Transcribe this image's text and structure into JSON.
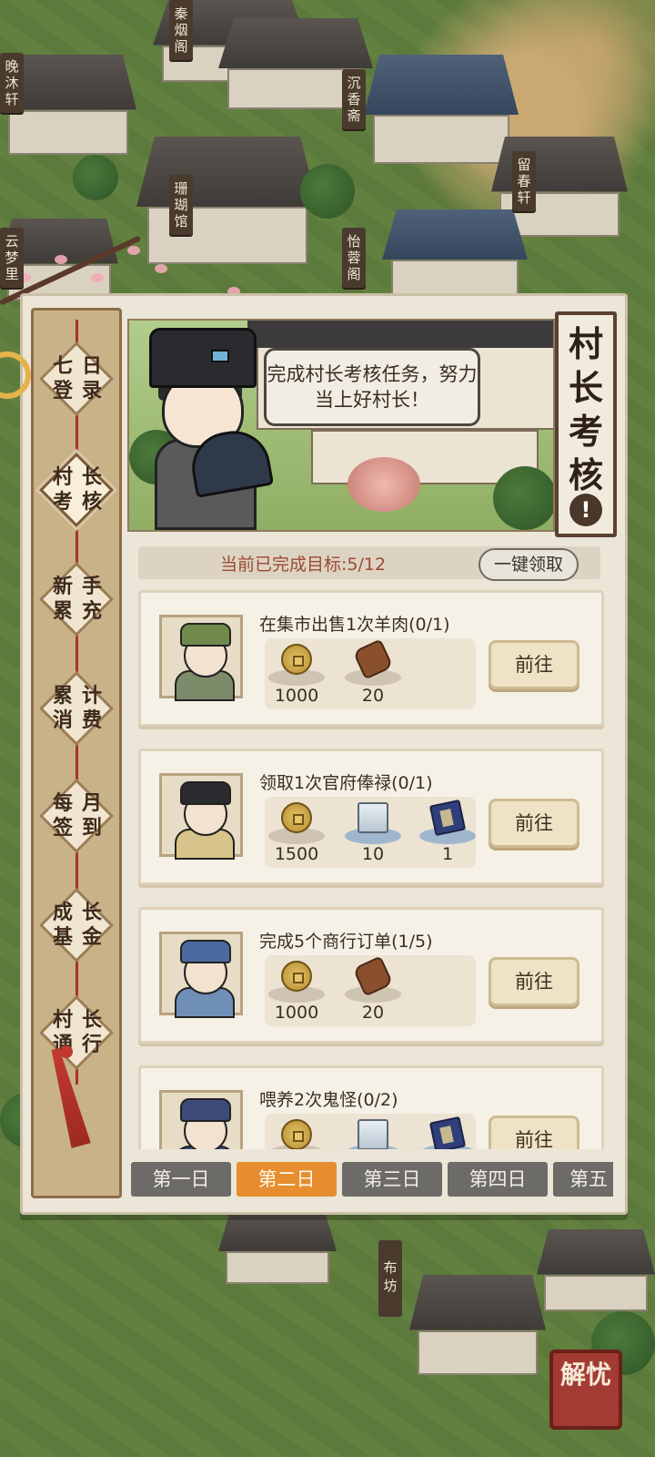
{
  "map": {
    "building_signs": [
      "秦烟阁",
      "晚沐轩",
      "沉香斋",
      "珊瑚馆",
      "留春轩",
      "云梦里",
      "怡蓉阁",
      "布坊"
    ]
  },
  "sidebar": {
    "items": [
      {
        "label": "七日登录",
        "active": false
      },
      {
        "label": "村长考核",
        "active": true
      },
      {
        "label": "新手累充",
        "active": false
      },
      {
        "label": "累计消费",
        "active": false
      },
      {
        "label": "每月签到",
        "active": false
      },
      {
        "label": "成长基金",
        "active": false
      },
      {
        "label": "村长通行",
        "active": false
      }
    ]
  },
  "banner": {
    "speech": "完成村长考核任务，努力当上好村长！",
    "title": "村长考核",
    "info_icon": "!"
  },
  "progress": {
    "text": "当前已完成目标:5/12",
    "claim_all_label": "一键领取"
  },
  "tasks": [
    {
      "title": "在集市出售1次羊肉(0/1)",
      "rewards": [
        {
          "icon": "copper-coin-icon",
          "qty": "1000"
        },
        {
          "icon": "wood-log-icon",
          "qty": "20"
        }
      ],
      "go_label": "前往"
    },
    {
      "title": "领取1次官府俸禄(0/1)",
      "rewards": [
        {
          "icon": "copper-coin-icon",
          "qty": "1500"
        },
        {
          "icon": "stone-block-icon",
          "qty": "10"
        },
        {
          "icon": "book-icon",
          "qty": "1"
        }
      ],
      "go_label": "前往"
    },
    {
      "title": "完成5个商行订单(1/5)",
      "rewards": [
        {
          "icon": "copper-coin-icon",
          "qty": "1000"
        },
        {
          "icon": "wood-log-icon",
          "qty": "20"
        }
      ],
      "go_label": "前往"
    },
    {
      "title": "喂养2次鬼怪(0/2)",
      "rewards": [
        {
          "icon": "copper-coin-icon",
          "qty": ""
        },
        {
          "icon": "stone-block-icon",
          "qty": ""
        },
        {
          "icon": "book-icon",
          "qty": ""
        }
      ],
      "go_label": "前往"
    }
  ],
  "day_tabs": [
    {
      "label": "第一日",
      "active": false
    },
    {
      "label": "第二日",
      "active": true
    },
    {
      "label": "第三日",
      "active": false
    },
    {
      "label": "第四日",
      "active": false
    },
    {
      "label": "第五",
      "active": false
    }
  ],
  "corner_seal": "解忧",
  "colors": {
    "active_tab": "#e58d2f",
    "inactive_tab": "#6d6b68",
    "progress_text": "#9a4a37",
    "panel_bg": "#ece6d8",
    "sidebar_bg": "#c8b288"
  }
}
